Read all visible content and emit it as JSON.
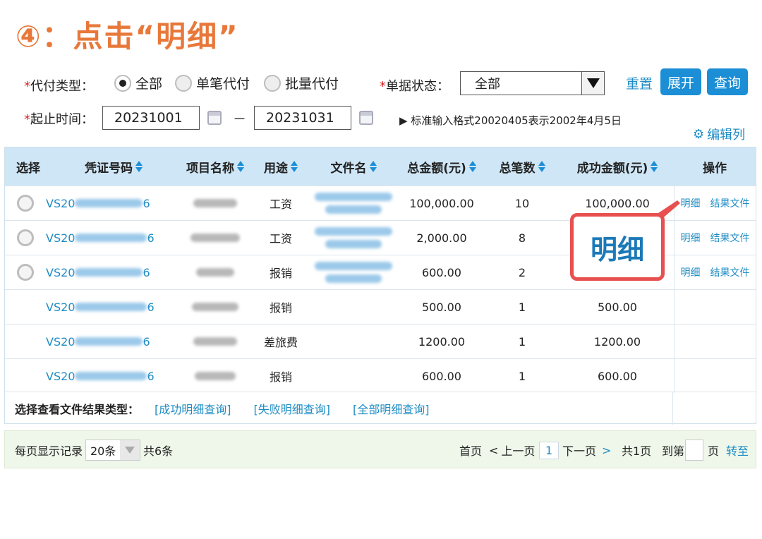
{
  "step_title": "④：点击“明细”",
  "filters": {
    "pay_type_label": "代付类型：",
    "pay_type_options": [
      "全部",
      "单笔代付",
      "批量代付"
    ],
    "pay_type_selected": "全部",
    "status_label": "单据状态：",
    "status_value": "全部",
    "reset_label": "重置",
    "expand_label": "展开",
    "query_label": "查询",
    "date_label": "起止时间：",
    "date_start": "20231001",
    "date_sep": "－",
    "date_end": "20231031",
    "date_hint": "▶ 标准输入格式20020405表示2002年4月5日",
    "edit_cols_label": "编辑列"
  },
  "table": {
    "headers": [
      "选择",
      "凭证号码",
      "项目名称",
      "用途",
      "文件名",
      "总金额(元)",
      "总笔数",
      "成功金额(元)",
      "操作"
    ],
    "rows": [
      {
        "voucher": "VS20",
        "voucher_tail": "6",
        "purpose": "工资",
        "total": "100,000.00",
        "count": "10",
        "success": "100,000.00",
        "has_radio": true,
        "ops": [
          "明细",
          "结果文件"
        ]
      },
      {
        "voucher": "VS20",
        "voucher_tail": "6",
        "purpose": "工资",
        "total": "2,000.00",
        "count": "8",
        "success": "",
        "has_radio": true,
        "ops": [
          "明细",
          "结果文件"
        ]
      },
      {
        "voucher": "VS20",
        "voucher_tail": "6",
        "purpose": "报销",
        "total": "600.00",
        "count": "2",
        "success": "",
        "has_radio": true,
        "ops": [
          "明细",
          "结果文件"
        ]
      },
      {
        "voucher": "VS20",
        "voucher_tail": "6",
        "purpose": "报销",
        "total": "500.00",
        "count": "1",
        "success": "500.00",
        "has_radio": false,
        "ops": []
      },
      {
        "voucher": "VS20",
        "voucher_tail": "6",
        "purpose": "差旅费",
        "total": "1200.00",
        "count": "1",
        "success": "1200.00",
        "has_radio": false,
        "ops": []
      },
      {
        "voucher": "VS20",
        "voucher_tail": "6",
        "purpose": "报销",
        "total": "600.00",
        "count": "1",
        "success": "600.00",
        "has_radio": false,
        "ops": []
      }
    ],
    "file_type_label": "选择查看文件结果类型：",
    "file_type_links": [
      "[成功明细查询]",
      "[失败明细查询]",
      "[全部明细查询]"
    ]
  },
  "callout_text": "明细",
  "pager": {
    "per_page_label": "每页显示记录",
    "per_page_value": "20条",
    "total_label": "共6条",
    "first": "首页",
    "prev": "上一页",
    "current": "1",
    "next": "下一页",
    "pages_total": "共1页",
    "goto_label": "到第",
    "page_unit": "页",
    "go_label": "转至"
  },
  "colors": {
    "accent": "#1b8ed6",
    "title": "#e8783a",
    "callout_border": "#e85050",
    "header_bg": "#cfe6f6"
  }
}
